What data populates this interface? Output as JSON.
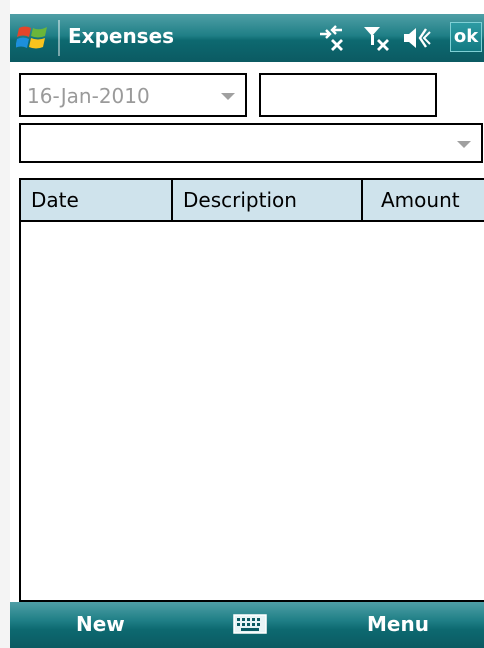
{
  "titlebar": {
    "app_title": "Expenses",
    "ok_label": "ok",
    "icons": [
      "windows-start-icon",
      "connectivity-icon",
      "signal-icon",
      "volume-icon"
    ]
  },
  "form": {
    "date_value": "16-Jan-2010",
    "amount_value": "",
    "category_value": ""
  },
  "list": {
    "columns": [
      "Date",
      "Description",
      "Amount"
    ],
    "rows": []
  },
  "softkeys": {
    "left_label": "New",
    "right_label": "Menu",
    "center_icon": "keyboard-icon"
  },
  "colors": {
    "bar_teal": "#1f7f86",
    "header_bg": "#cfe3ec",
    "placeholder_gray": "#9a9a9a"
  }
}
